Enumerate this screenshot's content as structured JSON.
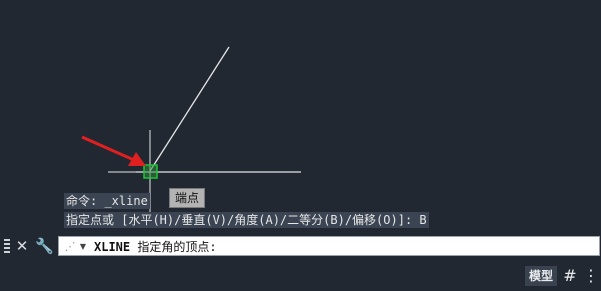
{
  "canvas": {
    "tooltip": "端点",
    "history": [
      "命令: _xline",
      "指定点或 [水平(H)/垂直(V)/角度(A)/二等分(B)/偏移(O)]: B"
    ]
  },
  "command_line": {
    "command": "XLINE",
    "prompt": " 指定角的顶点:",
    "close_icon": "close-icon",
    "customize_icon": "wrench-icon"
  },
  "status_bar": {
    "model_label": "模型",
    "grid_icon": "grid-icon",
    "more_icon": "more-icon"
  },
  "colors": {
    "background": "#212832",
    "line": "#e6e6e6",
    "snap_marker": "#22a33a",
    "arrow": "#e02020",
    "history_bg": "#3b4452"
  }
}
